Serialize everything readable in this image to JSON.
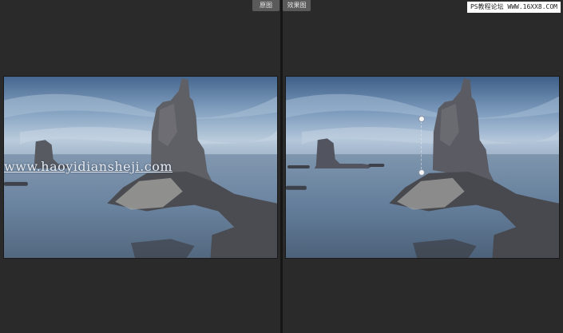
{
  "tabs": {
    "before_label": "原图",
    "after_label": "效果图"
  },
  "site_tag": "PS教程论坛 WWW.16XX8.COM",
  "watermark": "www.haoyidiansheji.com",
  "colors": {
    "sky_light": "#c4d2e3",
    "sky_dark": "#4a6a92",
    "sea": "#6e88a4",
    "rock": "#5e6066"
  }
}
